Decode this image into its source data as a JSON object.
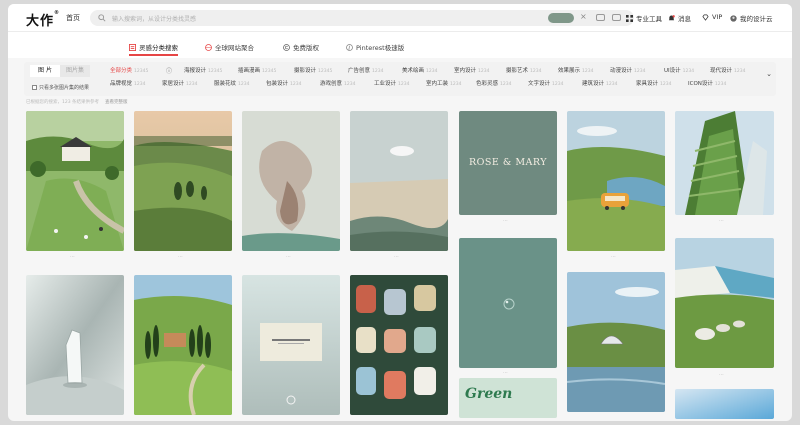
{
  "header": {
    "logo": "大作",
    "logo_reg": "®",
    "home": "首页",
    "search_placeholder": "输入搜索词，从设计分类找灵感",
    "tools": [
      {
        "label": "专业工具",
        "icon": "grid-icon"
      },
      {
        "label": "消息",
        "icon": "bell-icon"
      },
      {
        "label": "VIP",
        "icon": "diamond-icon"
      },
      {
        "label": "我的设计云",
        "icon": "avatar-icon"
      }
    ]
  },
  "categories": [
    {
      "label": "灵感分类搜索",
      "icon": "inspiration-icon",
      "active": true
    },
    {
      "label": "全球网站聚合",
      "icon": "globe-icon",
      "active": false
    },
    {
      "label": "免费版权",
      "icon": "copyright-icon",
      "active": false
    },
    {
      "label": "Pinterest极速版",
      "icon": "pinterest-icon",
      "active": false
    }
  ],
  "filter": {
    "tabs": [
      "图 片",
      "图片集"
    ],
    "check_label": "只看多张图片集的结果",
    "row1": [
      {
        "label": "全部分类",
        "count": "12345"
      },
      {
        "label": "海报设计",
        "count": "12345"
      },
      {
        "label": "插画漫画",
        "count": "12345"
      },
      {
        "label": "摄影设计",
        "count": "12345"
      },
      {
        "label": "广告创意",
        "count": "1234"
      },
      {
        "label": "美术绘画",
        "count": "1234"
      },
      {
        "label": "室内设计",
        "count": "1234"
      },
      {
        "label": "摄影艺术",
        "count": "1234"
      },
      {
        "label": "效果展示",
        "count": "1234"
      },
      {
        "label": "动漫设计",
        "count": "1234"
      },
      {
        "label": "UI设计",
        "count": "1234"
      },
      {
        "label": "现代设计",
        "count": "1234"
      }
    ],
    "row2": [
      {
        "label": "品牌视觉",
        "count": "1234"
      },
      {
        "label": "家居设计",
        "count": "1234"
      },
      {
        "label": "服装花纹",
        "count": "1234"
      },
      {
        "label": "包装设计",
        "count": "1234"
      },
      {
        "label": "游戏创意",
        "count": "1234"
      },
      {
        "label": "工业设计",
        "count": "1234"
      },
      {
        "label": "室内工装",
        "count": "1234"
      },
      {
        "label": "色彩灵感",
        "count": "1234"
      },
      {
        "label": "文字设计",
        "count": "1234"
      },
      {
        "label": "建筑设计",
        "count": "1234"
      },
      {
        "label": "家具设计",
        "count": "1234"
      },
      {
        "label": "ICON设计",
        "count": "1234"
      }
    ]
  },
  "hint": "已根据您的搜索，123 条结果供参考",
  "hint_link": "查看完整版",
  "tiles": [
    {
      "name": "village-landscape",
      "text": ""
    },
    {
      "name": "green-valley",
      "text": ""
    },
    {
      "name": "abstract-smoke",
      "text": ""
    },
    {
      "name": "cloud-mountain",
      "text": ""
    },
    {
      "name": "rose-mary-cover",
      "text": "ROSE & MARY"
    },
    {
      "name": "van-meadow",
      "text": ""
    },
    {
      "name": "vertical-forest-building",
      "text": ""
    },
    {
      "name": "glass-crystal",
      "text": ""
    },
    {
      "name": "tuscany-cypress",
      "text": ""
    },
    {
      "name": "book-mockup",
      "text": ""
    },
    {
      "name": "color-swatches",
      "text": ""
    },
    {
      "name": "teal-water-drop",
      "text": ""
    },
    {
      "name": "dome-house",
      "text": ""
    },
    {
      "name": "sheep-cliffs",
      "text": ""
    },
    {
      "name": "green-poster",
      "text": "Green"
    },
    {
      "name": "blue-gradient",
      "text": ""
    }
  ],
  "colors": {
    "accent": "#e64545",
    "toggle": "#7f9789",
    "rose_mary_bg": "#6f8a80",
    "teal_tile": "#6a9288"
  }
}
